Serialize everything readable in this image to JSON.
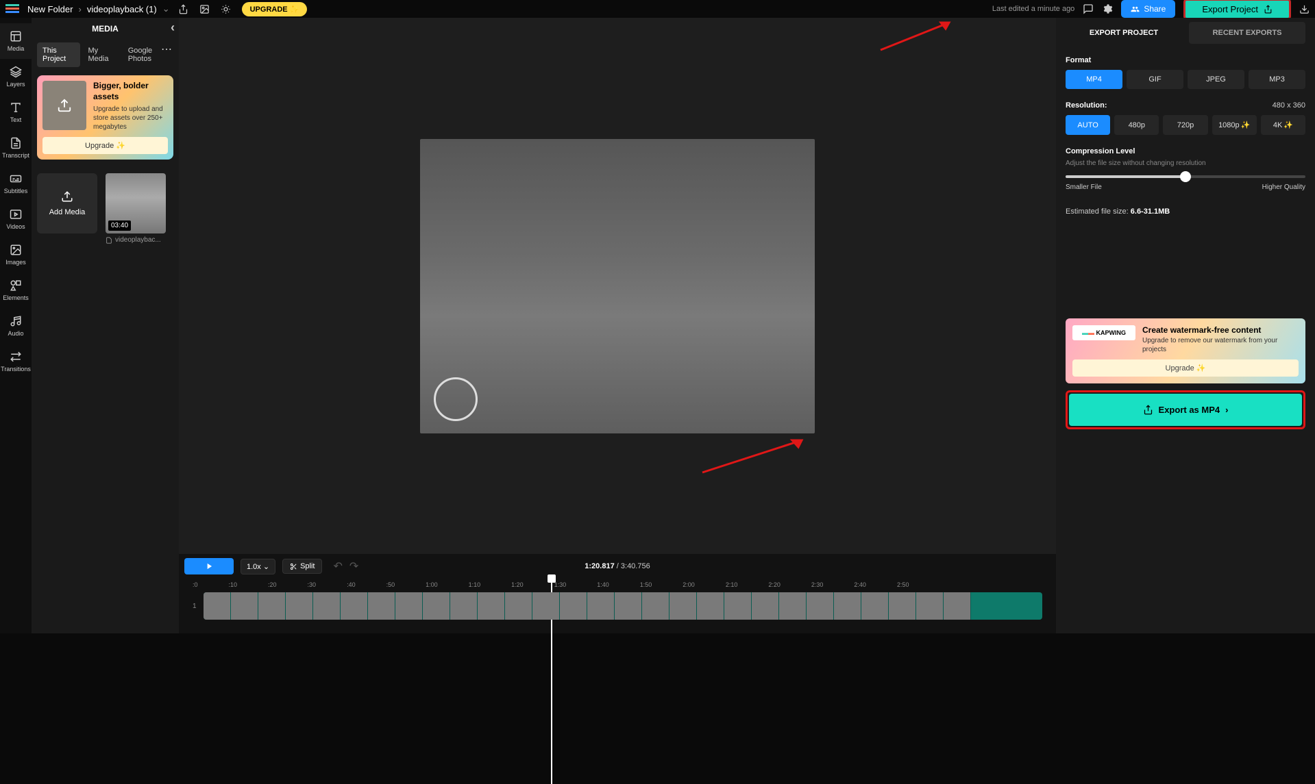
{
  "topbar": {
    "folder": "New Folder",
    "project": "videoplayback (1)",
    "upgrade": "UPGRADE ✨",
    "last_edited": "Last edited a minute ago",
    "share": "Share",
    "export": "Export Project"
  },
  "rail": {
    "items": [
      {
        "label": "Media"
      },
      {
        "label": "Layers"
      },
      {
        "label": "Text"
      },
      {
        "label": "Transcript"
      },
      {
        "label": "Subtitles"
      },
      {
        "label": "Videos"
      },
      {
        "label": "Images"
      },
      {
        "label": "Elements"
      },
      {
        "label": "Audio"
      },
      {
        "label": "Transitions"
      }
    ]
  },
  "panel": {
    "title": "MEDIA",
    "tabs": [
      "This Project",
      "My Media",
      "Google Photos"
    ],
    "promo": {
      "title": "Bigger, bolder assets",
      "sub": "Upgrade to upload and store assets over 250+ megabytes",
      "btn": "Upgrade ✨"
    },
    "add_media": "Add Media",
    "clip": {
      "duration": "03:40",
      "name": "videoplaybac..."
    }
  },
  "timeline": {
    "speed": "1.0x",
    "split": "Split",
    "current": "1:20.817",
    "total": "3:40.756",
    "ticks": [
      ":0",
      ":10",
      ":20",
      ":30",
      ":40",
      ":50",
      "1:00",
      "1:10",
      "1:20",
      "1:30",
      "1:40",
      "1:50",
      "2:00",
      "2:10",
      "2:20",
      "2:30",
      "2:40",
      "2:50"
    ],
    "track_num": "1"
  },
  "export": {
    "tabs": [
      "EXPORT PROJECT",
      "RECENT EXPORTS"
    ],
    "format_label": "Format",
    "formats": [
      "MP4",
      "GIF",
      "JPEG",
      "MP3"
    ],
    "resolution_label": "Resolution:",
    "resolution_value": "480 x 360",
    "resolutions": [
      {
        "label": "AUTO",
        "spark": false
      },
      {
        "label": "480p",
        "spark": false
      },
      {
        "label": "720p",
        "spark": false
      },
      {
        "label": "1080p",
        "spark": true
      },
      {
        "label": "4K",
        "spark": true
      }
    ],
    "compression_label": "Compression Level",
    "compression_sub": "Adjust the file size without changing resolution",
    "slider_left": "Smaller File",
    "slider_right": "Higher Quality",
    "est_label": "Estimated file size:",
    "est_value": "6.6-31.1MB",
    "watermark": {
      "logo": "KAPWING",
      "title": "Create watermark-free content",
      "sub": "Upgrade to remove our watermark from your projects",
      "btn": "Upgrade ✨"
    },
    "export_as": "Export as MP4"
  }
}
